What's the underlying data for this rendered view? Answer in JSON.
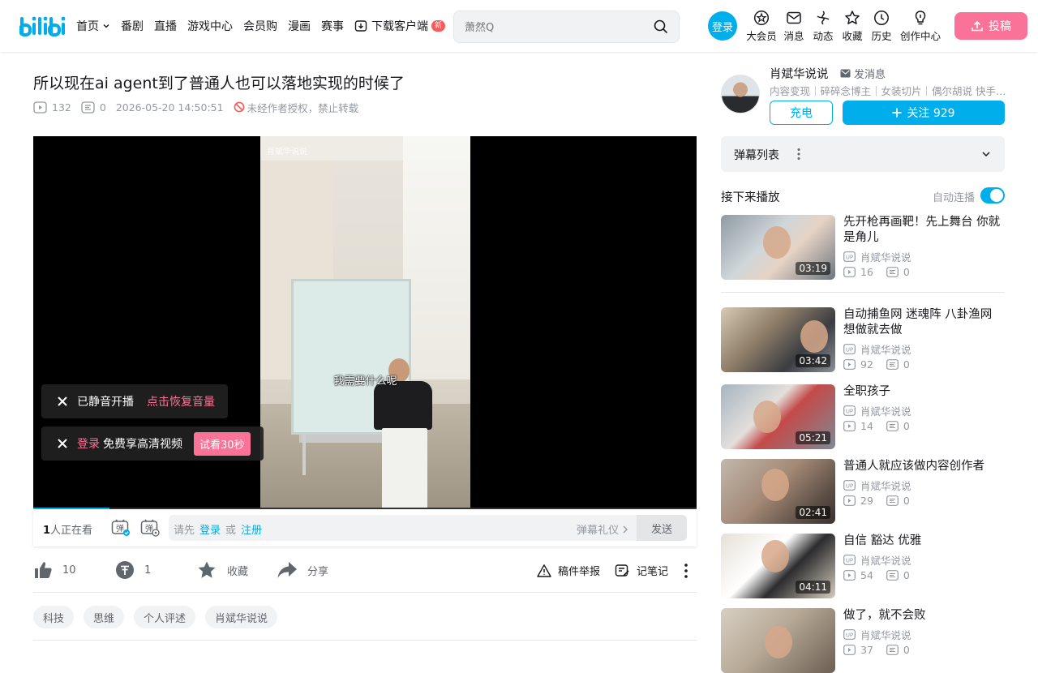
{
  "header": {
    "nav": [
      "首页",
      "番剧",
      "直播",
      "游戏中心",
      "会员购",
      "漫画",
      "赛事",
      "下载客户端"
    ],
    "new_badge": "新",
    "search_placeholder": "萧然Q",
    "login": "登录",
    "icons": [
      {
        "label": "大会员",
        "icon": "vip-icon"
      },
      {
        "label": "消息",
        "icon": "message-icon"
      },
      {
        "label": "动态",
        "icon": "dynamic-icon"
      },
      {
        "label": "收藏",
        "icon": "favorite-icon"
      },
      {
        "label": "历史",
        "icon": "history-icon"
      },
      {
        "label": "创作中心",
        "icon": "creator-icon"
      }
    ],
    "upload": "投稿",
    "brand_color": "#00aeec",
    "pink": "#fb7299"
  },
  "video": {
    "title": "所以现在ai agent到了普通人也可以落地实现的时候了",
    "plays": "132",
    "danmaku": "0",
    "date": "2026-05-20 14:50:51",
    "copyright": "未经作者授权，禁止转载",
    "watermark": "肖斌华说说",
    "subtitle": "我需要什么呢",
    "progress_fraction": 0.115
  },
  "toasts": {
    "muted": "已静音开播",
    "restore": "点击恢复音量",
    "login": "登录",
    "hd": "免费享高清视频",
    "trial": "试看30秒"
  },
  "danmaku_bar": {
    "viewers_count": "1",
    "viewers_text": "人正在看",
    "prompt_before": "请先",
    "login": "登录",
    "or": "或",
    "register": "注册",
    "etiquette": "弹幕礼仪",
    "send": "发送"
  },
  "actions": {
    "like": "10",
    "coin": "1",
    "favorite": "收藏",
    "share": "分享",
    "report": "稿件举报",
    "notes": "记笔记"
  },
  "tags": [
    "科技",
    "思维",
    "个人评述",
    "肖斌华说说"
  ],
  "uploader": {
    "name": "肖斌华说说",
    "message": "发消息",
    "desc": "内容变现｜碎碎念博主｜女装切片｜偶尔胡说 快手同名",
    "charge": "充电",
    "follow": "关注 929"
  },
  "danmaku_list": {
    "label": "弹幕列表"
  },
  "next": {
    "title": "接下来播放",
    "autoplay": "自动连播",
    "autoplay_on": true
  },
  "recommendations": [
    {
      "title": "先开枪再画靶！先上舞台 你就是角儿",
      "duration": "03:19",
      "up": "肖斌华说说",
      "plays": "16",
      "danmaku": "0"
    },
    {
      "title": "自动捕鱼网 迷魂阵 八卦渔网 想做就去做",
      "duration": "03:42",
      "up": "肖斌华说说",
      "plays": "92",
      "danmaku": "0"
    },
    {
      "title": "全职孩子",
      "duration": "05:21",
      "up": "肖斌华说说",
      "plays": "14",
      "danmaku": "0"
    },
    {
      "title": "普通人就应该做内容创作者",
      "duration": "02:41",
      "up": "肖斌华说说",
      "plays": "29",
      "danmaku": "0"
    },
    {
      "title": "自信 豁达 优雅",
      "duration": "04:11",
      "up": "肖斌华说说",
      "plays": "54",
      "danmaku": "0"
    },
    {
      "title": "做了，就不会败",
      "duration": "",
      "up": "肖斌华说说",
      "plays": "37",
      "danmaku": "0"
    }
  ]
}
